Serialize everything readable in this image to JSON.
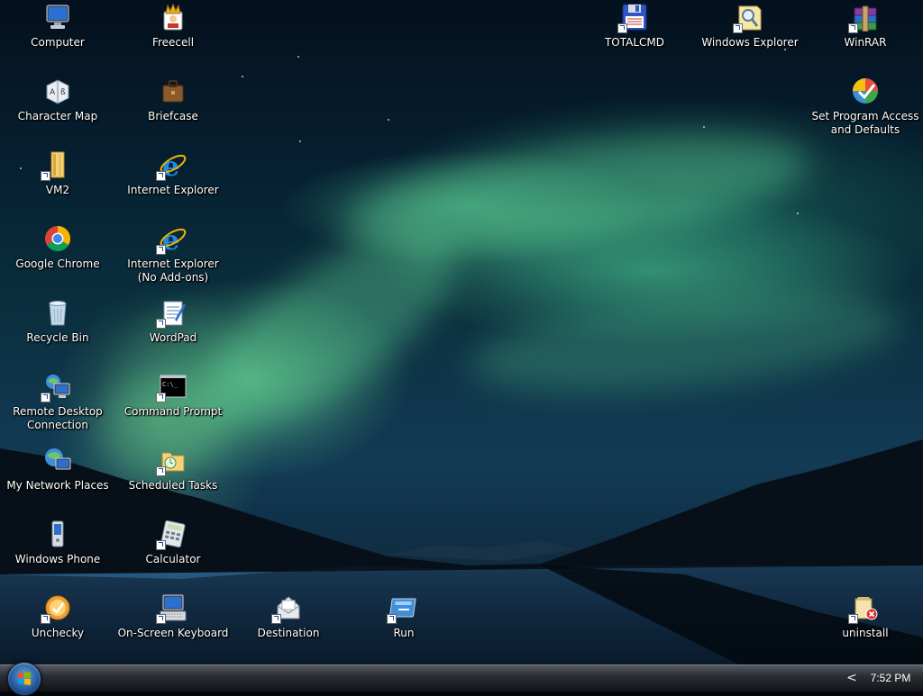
{
  "desktop": {
    "icons": [
      {
        "label": "Computer",
        "icon": "computer-icon"
      },
      {
        "label": "Freecell",
        "icon": "freecell-icon"
      },
      {
        "label": "TOTALCMD",
        "icon": "totalcmd-icon"
      },
      {
        "label": "Windows Explorer",
        "icon": "windows-explorer-icon"
      },
      {
        "label": "WinRAR",
        "icon": "winrar-icon"
      },
      {
        "label": "Character Map",
        "icon": "character-map-icon"
      },
      {
        "label": "Briefcase",
        "icon": "briefcase-icon"
      },
      {
        "label": "Set Program Access and Defaults",
        "icon": "program-defaults-icon"
      },
      {
        "label": "VM2",
        "icon": "folder-icon"
      },
      {
        "label": "Internet Explorer",
        "icon": "internet-explorer-icon"
      },
      {
        "label": "Google Chrome",
        "icon": "chrome-icon"
      },
      {
        "label": "Internet Explorer (No Add-ons)",
        "icon": "internet-explorer-icon"
      },
      {
        "label": "Recycle Bin",
        "icon": "recycle-bin-icon"
      },
      {
        "label": "WordPad",
        "icon": "wordpad-icon"
      },
      {
        "label": "Remote Desktop Connection",
        "icon": "remote-desktop-icon"
      },
      {
        "label": "Command Prompt",
        "icon": "command-prompt-icon"
      },
      {
        "label": "My Network Places",
        "icon": "network-places-icon"
      },
      {
        "label": "Scheduled Tasks",
        "icon": "scheduled-tasks-icon"
      },
      {
        "label": "Windows Phone",
        "icon": "windows-phone-icon"
      },
      {
        "label": "Calculator",
        "icon": "calculator-icon"
      },
      {
        "label": "Unchecky",
        "icon": "unchecky-icon"
      },
      {
        "label": "On-Screen Keyboard",
        "icon": "keyboard-icon"
      },
      {
        "label": "Destination",
        "icon": "destination-icon"
      },
      {
        "label": "Run",
        "icon": "run-icon"
      },
      {
        "label": "uninstall",
        "icon": "uninstall-icon"
      }
    ]
  },
  "taskbar": {
    "start_icon": "windows-start-icon",
    "tray_arrow": "<",
    "clock": "7:52 PM"
  }
}
